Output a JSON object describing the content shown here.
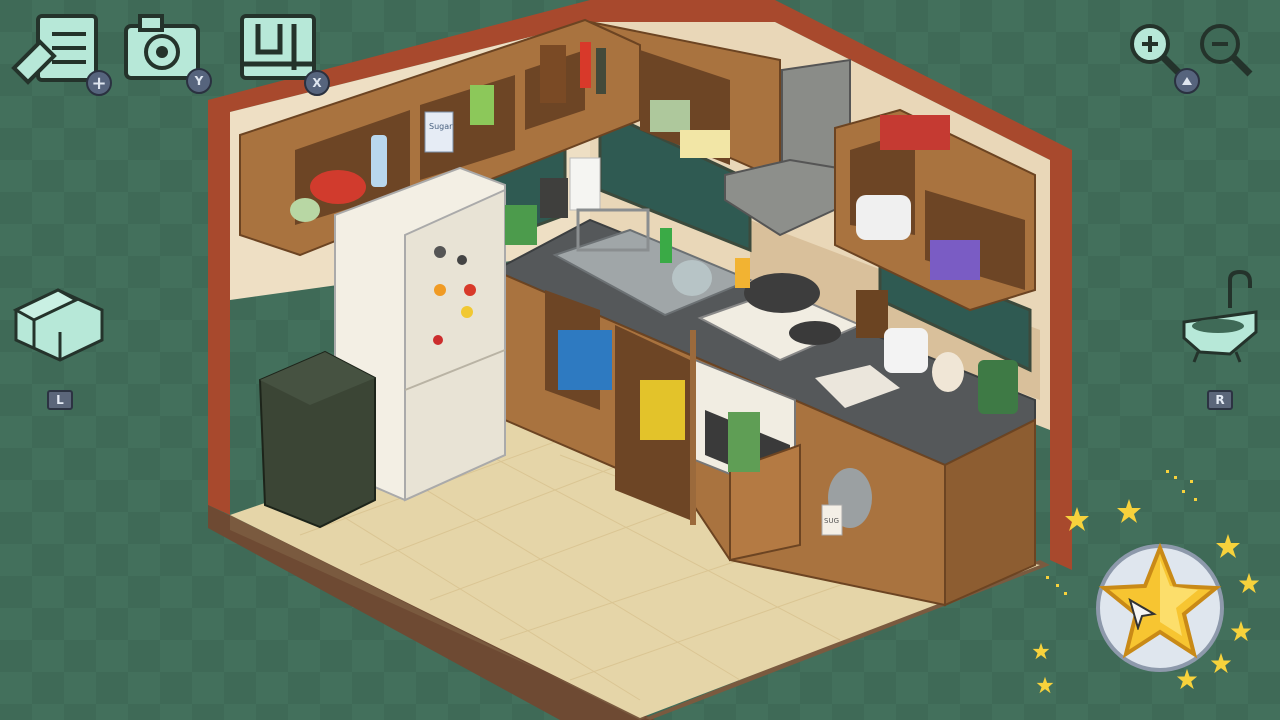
{
  "hud": {
    "edit_list_button": {
      "badge_icon": "plus-icon"
    },
    "camera_button": {
      "key": "Y"
    },
    "room_layout_button": {
      "key": "X"
    },
    "zoom": {
      "zoom_in_icon": "zoom-in-icon",
      "zoom_out_icon": "zoom-out-icon",
      "key_icon": "triangle-icon"
    },
    "prev_room_button": {
      "icon": "sofa-icon",
      "key": "L"
    },
    "next_room_button": {
      "icon": "bathtub-icon",
      "key": "R"
    },
    "complete_button": {
      "icon": "star-icon"
    }
  },
  "room": {
    "labels": {
      "sugar_box": "Sugar",
      "sugar_jar": "SUG"
    }
  },
  "colors": {
    "background": "#3f6a57",
    "wood": "#a9733f",
    "counter": "#55585a",
    "floor": "#e5d5a8",
    "accent_star": "#f7c531"
  }
}
